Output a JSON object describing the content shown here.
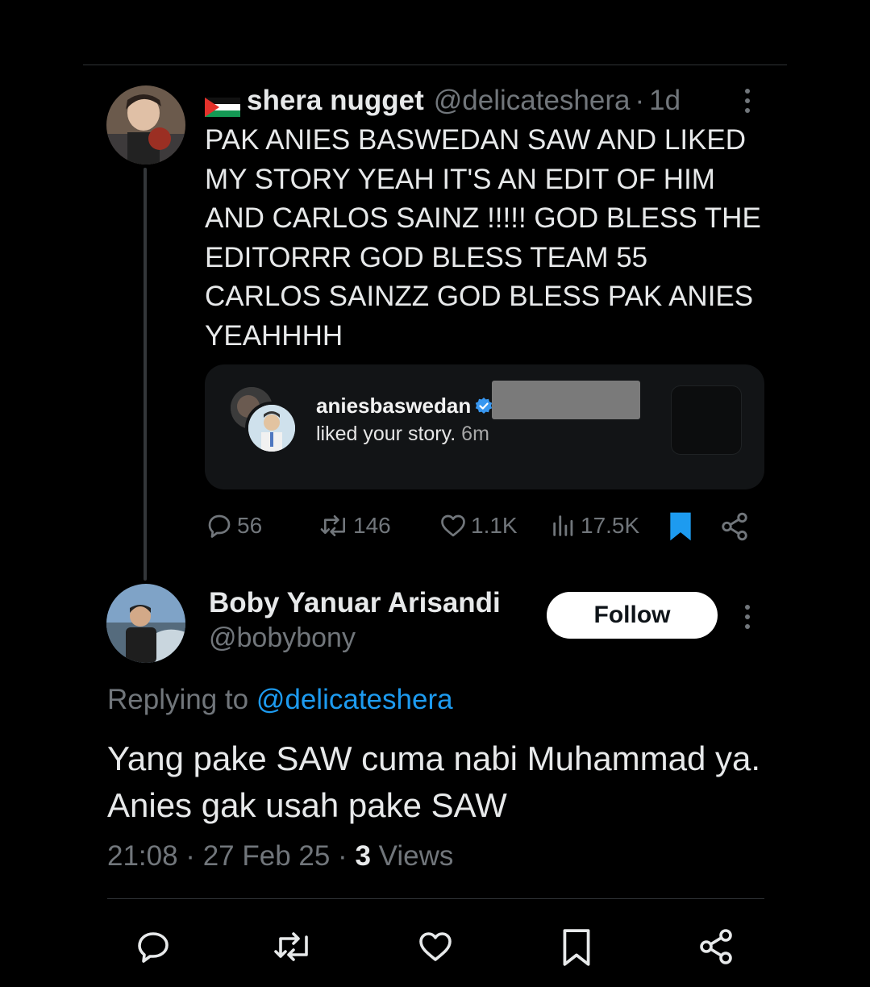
{
  "parent_tweet": {
    "display_name": "shera nugget",
    "handle": "@delicateshera",
    "separator": "·",
    "time": "1d",
    "body": "PAK ANIES BASWEDAN SAW AND LIKED\nMY STORY YEAH IT'S AN EDIT OF HIM\nAND CARLOS SAINZ !!!!! GOD BLESS THE\nEDITORRR GOD BLESS TEAM 55\nCARLOS SAINZZ GOD BLESS PAK ANIES\nYEAHHHH",
    "embedded_card": {
      "username": "aniesbaswedan",
      "action_text": "liked your story.",
      "time": "6m"
    },
    "stats": {
      "replies": "56",
      "reposts": "146",
      "likes": "1.1K",
      "views": "17.5K"
    }
  },
  "reply_tweet": {
    "display_name": "Boby Yanuar Arisandi",
    "handle": "@bobybony",
    "follow_label": "Follow",
    "replying_prefix": "Replying to",
    "replying_to": "@delicateshera",
    "body": "Yang pake SAW cuma nabi Muhammad ya. Anies gak usah pake SAW",
    "timestamp": "21:08 · 27 Feb 25 ·",
    "views_count": "3",
    "views_label": "Views"
  },
  "colors": {
    "background": "#000000",
    "text": "#e7e9ea",
    "muted": "#71767b",
    "accent": "#1d9bf0"
  },
  "icons": [
    "palestine-flag-icon",
    "more-icon",
    "reply-icon",
    "repost-icon",
    "like-icon",
    "views-icon",
    "bookmark-icon",
    "share-icon",
    "verified-icon"
  ]
}
